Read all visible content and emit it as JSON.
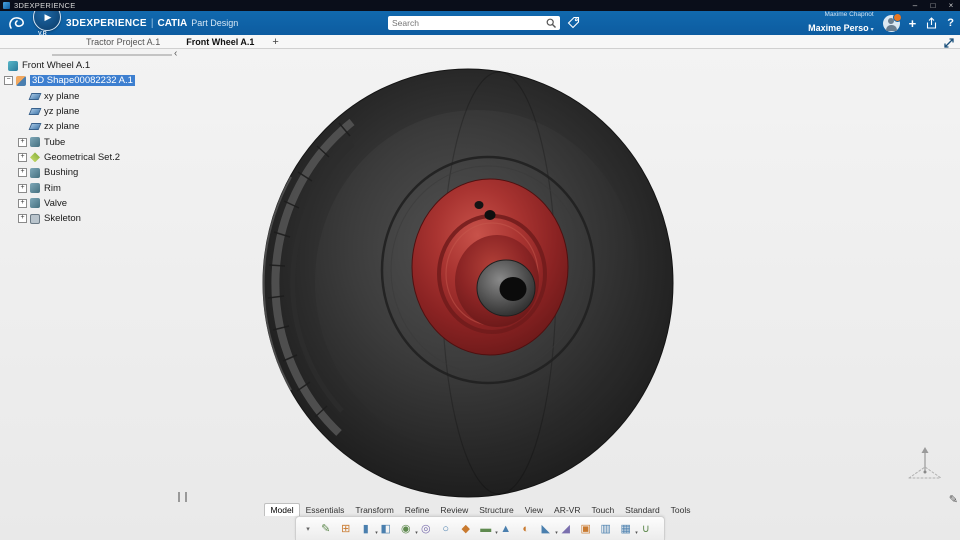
{
  "titlebar": {
    "app": "3DEXPERIENCE",
    "minimize": "–",
    "maximize": "□",
    "close": "×"
  },
  "header": {
    "brand": "3DEXPERIENCE",
    "sep": "|",
    "app": "CATIA",
    "module": "Part Design",
    "compass_play": "▶",
    "compass_label": "V.R",
    "search_placeholder": "Search",
    "user_name": "Maxime Chapnot",
    "account_name": "Maxime Perso",
    "account_caret": "▾",
    "plus": "+",
    "help": "?",
    "accent_color": "#0f62a6",
    "badge_color": "#e87722"
  },
  "tabbar": {
    "tabs": [
      {
        "label": "Tractor Project A.1",
        "cls": ""
      },
      {
        "label": "Front Wheel A.1",
        "cls": "active"
      }
    ],
    "add": "+"
  },
  "tree": {
    "root": "Front Wheel A.1",
    "collapse": "‹",
    "items": [
      {
        "label": "3D Shape00082232 A.1",
        "icon": "shape",
        "cls": "lvl1 selected",
        "exp": "−"
      },
      {
        "label": "xy plane",
        "icon": "plane",
        "cls": "lvl2 noexp",
        "exp": ""
      },
      {
        "label": "yz plane",
        "icon": "plane",
        "cls": "lvl2 noexp",
        "exp": ""
      },
      {
        "label": "zx plane",
        "icon": "plane",
        "cls": "lvl2 noexp",
        "exp": ""
      },
      {
        "label": "Tube",
        "icon": "solid",
        "cls": "lvl2",
        "exp": "+"
      },
      {
        "label": "Geometrical Set.2",
        "icon": "geoset",
        "cls": "lvl2",
        "exp": "+"
      },
      {
        "label": "Bushing",
        "icon": "solid",
        "cls": "lvl2",
        "exp": "+"
      },
      {
        "label": "Rim",
        "icon": "solid",
        "cls": "lvl2",
        "exp": "+"
      },
      {
        "label": "Valve",
        "icon": "solid",
        "cls": "lvl2",
        "exp": "+"
      },
      {
        "label": "Skeleton",
        "icon": "skeleton",
        "cls": "lvl2",
        "exp": "+"
      }
    ],
    "selection_color": "#3d7fd0"
  },
  "viewport": {
    "background": "#f0f0f0",
    "tire_color": "#2f2f2f",
    "rim_color": "#a33030",
    "hub_color": "#555555",
    "pen_glyph": "✎"
  },
  "actionbar": {
    "collapse": "▾",
    "tabs": [
      {
        "label": "Model",
        "cls": "active"
      },
      {
        "label": "Essentials",
        "cls": ""
      },
      {
        "label": "Transform",
        "cls": ""
      },
      {
        "label": "Refine",
        "cls": ""
      },
      {
        "label": "Review",
        "cls": ""
      },
      {
        "label": "Structure",
        "cls": ""
      },
      {
        "label": "View",
        "cls": ""
      },
      {
        "label": "AR-VR",
        "cls": ""
      },
      {
        "label": "Touch",
        "cls": ""
      },
      {
        "label": "Standard",
        "cls": ""
      },
      {
        "label": "Tools",
        "cls": ""
      }
    ],
    "icons": [
      {
        "name": "sketch-icon",
        "g": "✎",
        "cls": ""
      },
      {
        "name": "positioned-sketch-icon",
        "g": "⊞",
        "cls": ""
      },
      {
        "name": "pad-icon",
        "g": "▮",
        "cls": "fly"
      },
      {
        "name": "pocket-icon",
        "g": "◧",
        "cls": ""
      },
      {
        "name": "shaft-icon",
        "g": "◉",
        "cls": "fly"
      },
      {
        "name": "groove-icon",
        "g": "◎",
        "cls": ""
      },
      {
        "name": "hole-icon",
        "g": "○",
        "cls": ""
      },
      {
        "name": "rib-icon",
        "g": "◆",
        "cls": ""
      },
      {
        "name": "slot-icon",
        "g": "▬",
        "cls": "fly"
      },
      {
        "name": "stiffener-icon",
        "g": "▲",
        "cls": ""
      },
      {
        "name": "fillet-icon",
        "g": "◐",
        "cls": ""
      },
      {
        "name": "chamfer-icon",
        "g": "◣",
        "cls": "fly"
      },
      {
        "name": "draft-icon",
        "g": "◢",
        "cls": ""
      },
      {
        "name": "shell-icon",
        "g": "▣",
        "cls": ""
      },
      {
        "name": "mirror-icon",
        "g": "▥",
        "cls": ""
      },
      {
        "name": "pattern-icon",
        "g": "▦",
        "cls": "fly"
      },
      {
        "name": "boolean-union-icon",
        "g": "∪",
        "cls": ""
      }
    ]
  }
}
